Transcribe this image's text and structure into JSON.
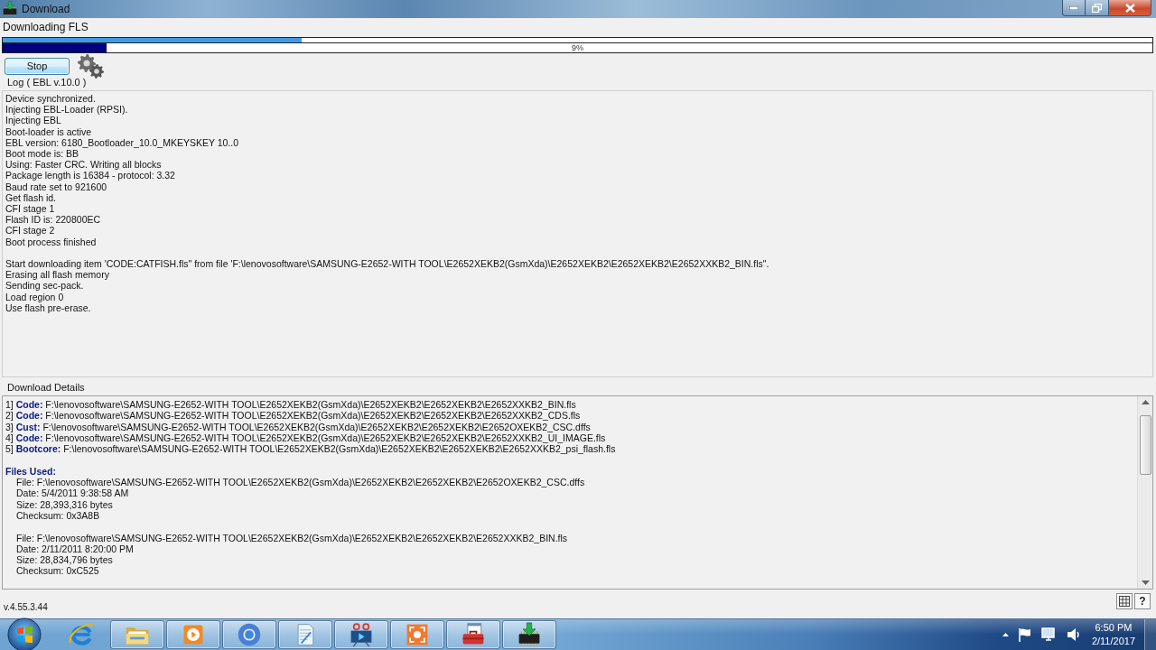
{
  "window": {
    "title": "Download"
  },
  "operation": {
    "label": "Downloading FLS"
  },
  "progress": [
    {
      "kind": "slim",
      "level": 0.26
    },
    {
      "kind": "bar",
      "level": 0.09,
      "reading": "9%"
    }
  ],
  "buttons": [
    {
      "label": "Stop"
    }
  ],
  "log": {
    "title": "Log ( EBL v.10.0 )",
    "blocks": [
      [
        "Device synchronized.",
        "Injecting EBL-Loader (RPSI).",
        "Injecting EBL",
        "Boot-loader is active",
        "EBL version: 6180_Bootloader_10.0_MKEYSKEY 10..0",
        "Boot mode is: BB",
        "Using: Faster CRC. Writing all blocks",
        "Package length is 16384 - protocol: 3.32",
        "Baud rate set to 921600",
        "Get flash id.",
        "CFI stage 1",
        "Flash ID is: 220800EC",
        "CFI stage 2",
        "Boot process finished"
      ],
      [
        "Start downloading item 'CODE:CATFISH.fls\" from file 'F:\\lenovosoftware\\SAMSUNG-E2652-WITH TOOL\\E2652XEKB2(GsmXda)\\E2652XEKB2\\E2652XEKB2\\E2652XXKB2_BIN.fls\".",
        "Erasing all flash memory",
        "Sending sec-pack.",
        "Load region 0",
        "Use flash pre-erase."
      ]
    ]
  },
  "download_details": {
    "title": "Download Details",
    "items": [
      "1] **Code:** F:\\lenovosoftware\\SAMSUNG-E2652-WITH TOOL\\E2652XEKB2(GsmXda)\\E2652XEKB2\\E2652XEKB2\\E2652XXKB2_BIN.fls",
      "2] **Code:** F:\\lenovosoftware\\SAMSUNG-E2652-WITH TOOL\\E2652XEKB2(GsmXda)\\E2652XEKB2\\E2652XEKB2\\E2652XXKB2_CDS.fls",
      "3] **Cust:** F:\\lenovosoftware\\SAMSUNG-E2652-WITH TOOL\\E2652XEKB2(GsmXda)\\E2652XEKB2\\E2652XEKB2\\E2652OXEKB2_CSC.dffs",
      "4] **Code:** F:\\lenovosoftware\\SAMSUNG-E2652-WITH TOOL\\E2652XEKB2(GsmXda)\\E2652XEKB2\\E2652XEKB2\\E2652XXKB2_UI_IMAGE.fls",
      "5] **Bootcore:** F:\\lenovosoftware\\SAMSUNG-E2652-WITH TOOL\\E2652XEKB2(GsmXda)\\E2652XEKB2\\E2652XEKB2\\E2652XXKB2_psi_flash.fls"
    ],
    "files_used": {
      "title": "Files Used:",
      "files": [
        {
          "file": "File: F:\\lenovosoftware\\SAMSUNG-E2652-WITH TOOL\\E2652XEKB2(GsmXda)\\E2652XEKB2\\E2652XEKB2\\E2652OXEKB2_CSC.dffs",
          "date": "Date: 5/4/2011 9:38:58 AM",
          "size": "Size: 28,393,316 bytes",
          "checksum": "Checksum: 0x3A8B"
        },
        {
          "file": "File: F:\\lenovosoftware\\SAMSUNG-E2652-WITH TOOL\\E2652XEKB2(GsmXda)\\E2652XEKB2\\E2652XEKB2\\E2652XXKB2_BIN.fls",
          "date": "Date: 2/11/2011 8:20:00 PM",
          "size": "Size: 28,834,796 bytes",
          "checksum": "Checksum: 0xC525"
        }
      ]
    }
  },
  "status_bar": {
    "version": "v.4.55.3.44",
    "help": "?"
  },
  "taskbar": {
    "apps": [
      {
        "kind": "e-globe",
        "running": false
      },
      {
        "kind": "folder",
        "running": true
      },
      {
        "kind": "play",
        "running": true
      },
      {
        "kind": "ring",
        "running": true
      },
      {
        "kind": "notepad",
        "running": true
      },
      {
        "kind": "film",
        "running": true
      },
      {
        "kind": "camera",
        "running": true
      },
      {
        "kind": "toolbox",
        "running": true
      },
      {
        "kind": "download-chip",
        "running": true
      }
    ],
    "clock": {
      "time": "6:50 PM",
      "date": "2/11/2017"
    }
  }
}
